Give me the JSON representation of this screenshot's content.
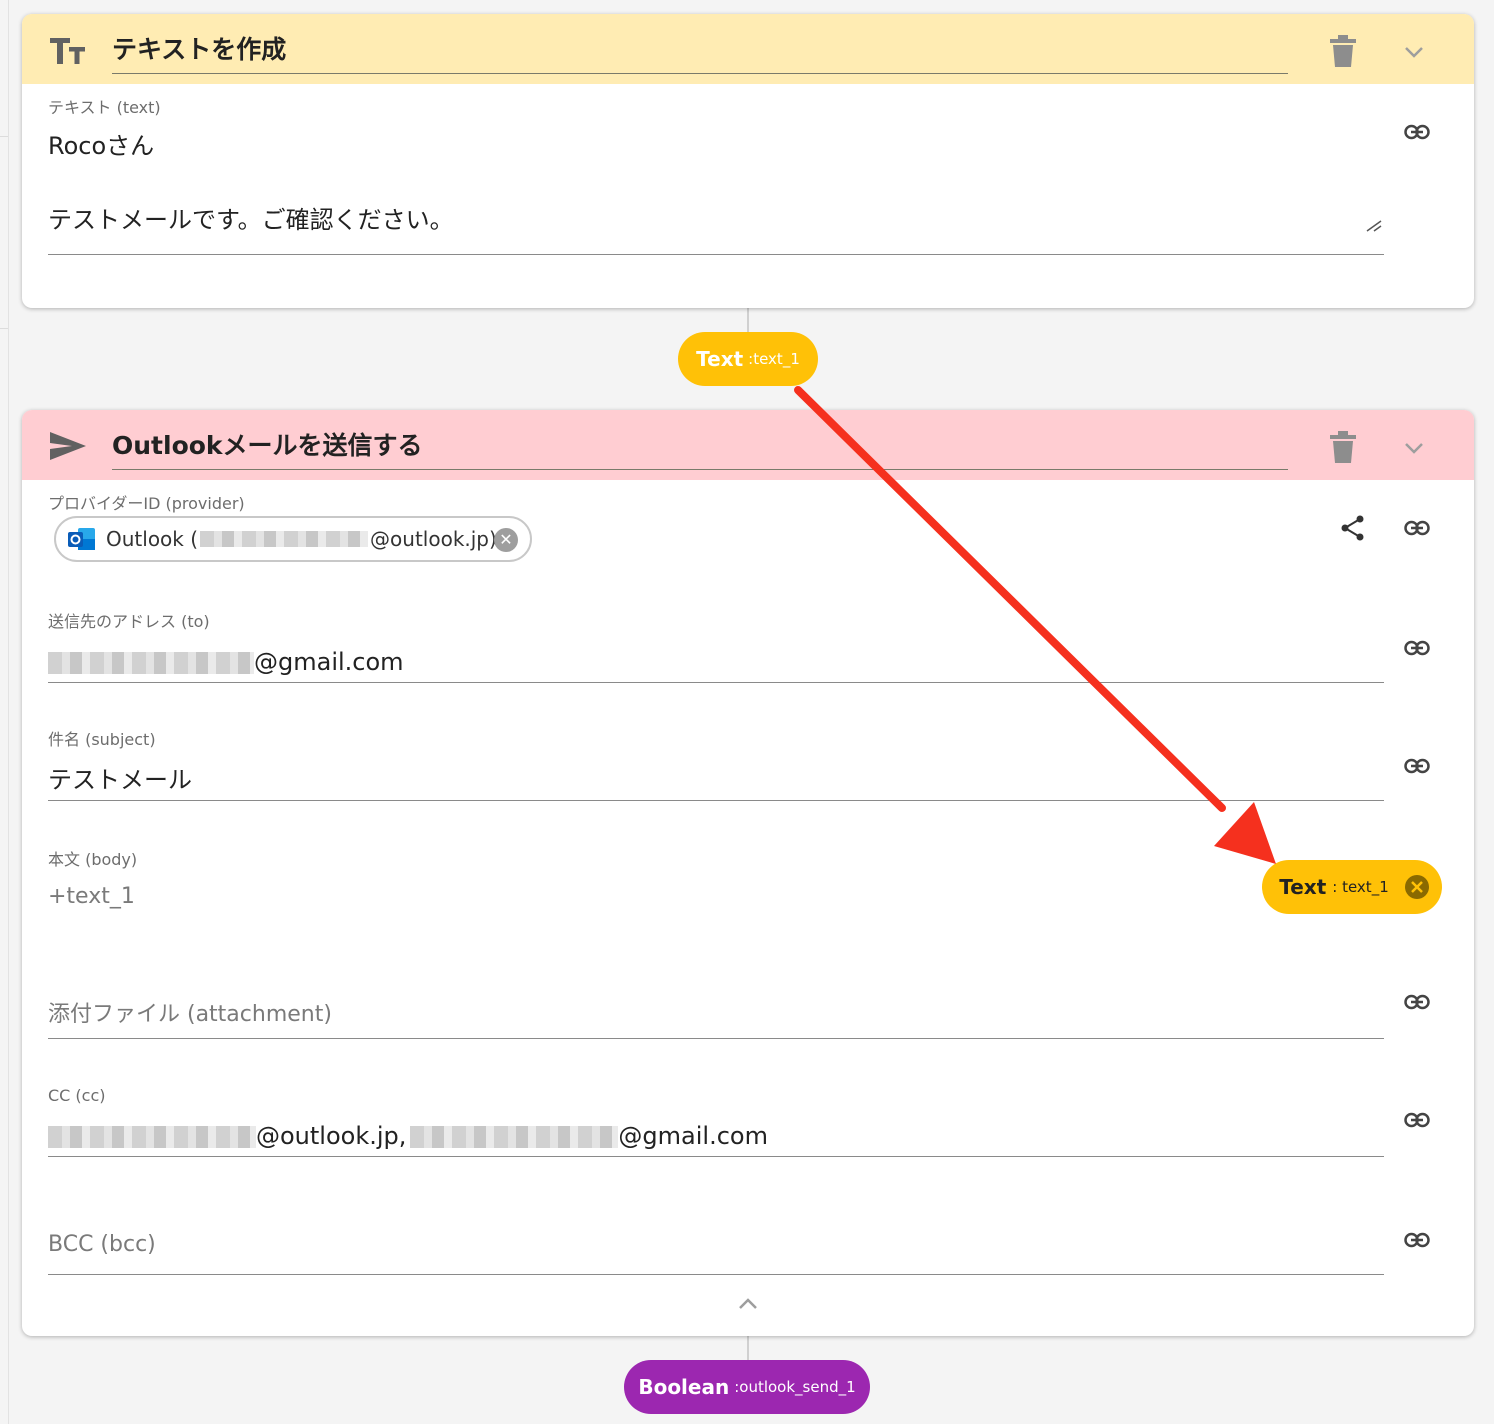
{
  "card1": {
    "title": "テキストを作成",
    "header_color": "#ffecb3",
    "field": {
      "label": "テキスト (text)",
      "value_line1": "Rocoさん",
      "value_line2": "テストメールです。ご確認ください。"
    }
  },
  "connector1": {
    "type": "Text",
    "name": ":text_1",
    "color": "#ffc107"
  },
  "card2": {
    "title": "Outlookメールを送信する",
    "header_color": "#ffcdd2",
    "provider": {
      "label": "プロバイダーID (provider)",
      "chip_prefix": "Outlook (",
      "chip_suffix": "@outlook.jp)"
    },
    "to": {
      "label": "送信先のアドレス (to)",
      "value_suffix": "@gmail.com"
    },
    "subject": {
      "label": "件名 (subject)",
      "value": "テストメール"
    },
    "body": {
      "label": "本文 (body)",
      "placeholder": "+text_1",
      "badge_type": "Text",
      "badge_name": ": text_1"
    },
    "attachment": {
      "placeholder": "添付ファイル (attachment)"
    },
    "cc": {
      "label": "CC (cc)",
      "value_part1": "@outlook.jp,",
      "value_part2": "@gmail.com"
    },
    "bcc": {
      "placeholder": "BCC (bcc)"
    }
  },
  "connector2": {
    "type": "Boolean",
    "name": ":outlook_send_1",
    "color": "#9c27b0"
  },
  "annotation": {
    "arrow_color": "#f5301e"
  },
  "icons": [
    "text-format-icon",
    "send-icon",
    "trash-icon",
    "chevron-down-icon",
    "chevron-up-icon",
    "link-icon",
    "share-icon",
    "outlook-logo-icon",
    "close-icon"
  ]
}
